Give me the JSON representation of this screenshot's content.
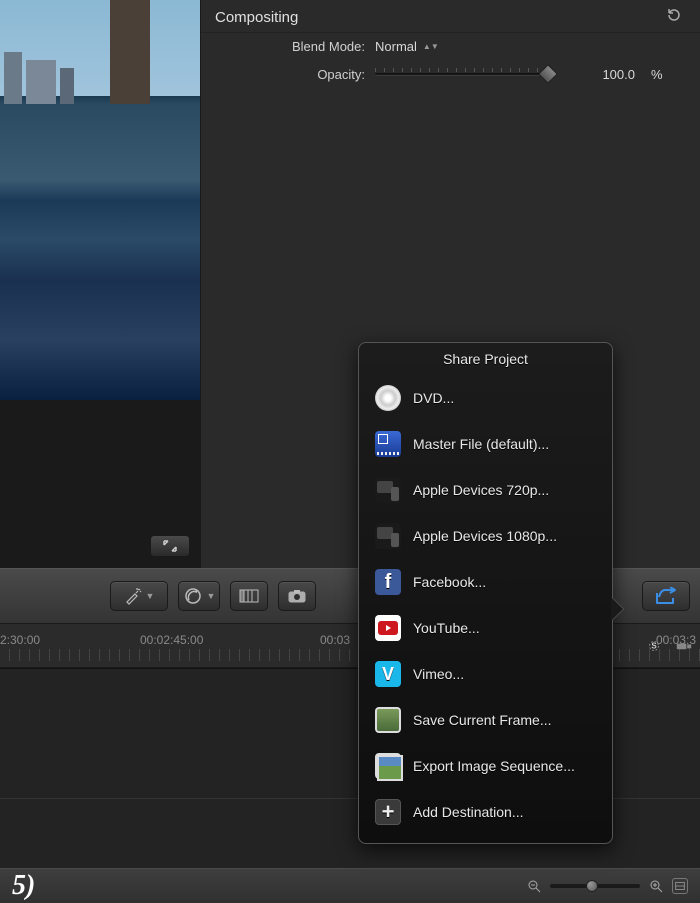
{
  "inspector": {
    "section_title": "Compositing",
    "blend_mode": {
      "label": "Blend Mode:",
      "value": "Normal"
    },
    "opacity": {
      "label": "Opacity:",
      "value": "100.0",
      "unit": "%",
      "slider_percent": 100
    }
  },
  "timeline": {
    "timecodes": [
      "2:30:00",
      "00:02:45:00",
      "00:03",
      "00:03:3"
    ]
  },
  "share_popover": {
    "title": "Share Project",
    "items": [
      {
        "icon": "dvd",
        "label": "DVD..."
      },
      {
        "icon": "master",
        "label": "Master File (default)..."
      },
      {
        "icon": "devices",
        "label": "Apple Devices 720p..."
      },
      {
        "icon": "devices",
        "label": "Apple Devices 1080p..."
      },
      {
        "icon": "fb",
        "label": "Facebook..."
      },
      {
        "icon": "yt",
        "label": "YouTube..."
      },
      {
        "icon": "vimeo",
        "label": "Vimeo..."
      },
      {
        "icon": "frame",
        "label": "Save Current Frame..."
      },
      {
        "icon": "seq",
        "label": "Export Image Sequence..."
      },
      {
        "icon": "add",
        "label": "Add Destination..."
      }
    ]
  },
  "step_label": "5)"
}
